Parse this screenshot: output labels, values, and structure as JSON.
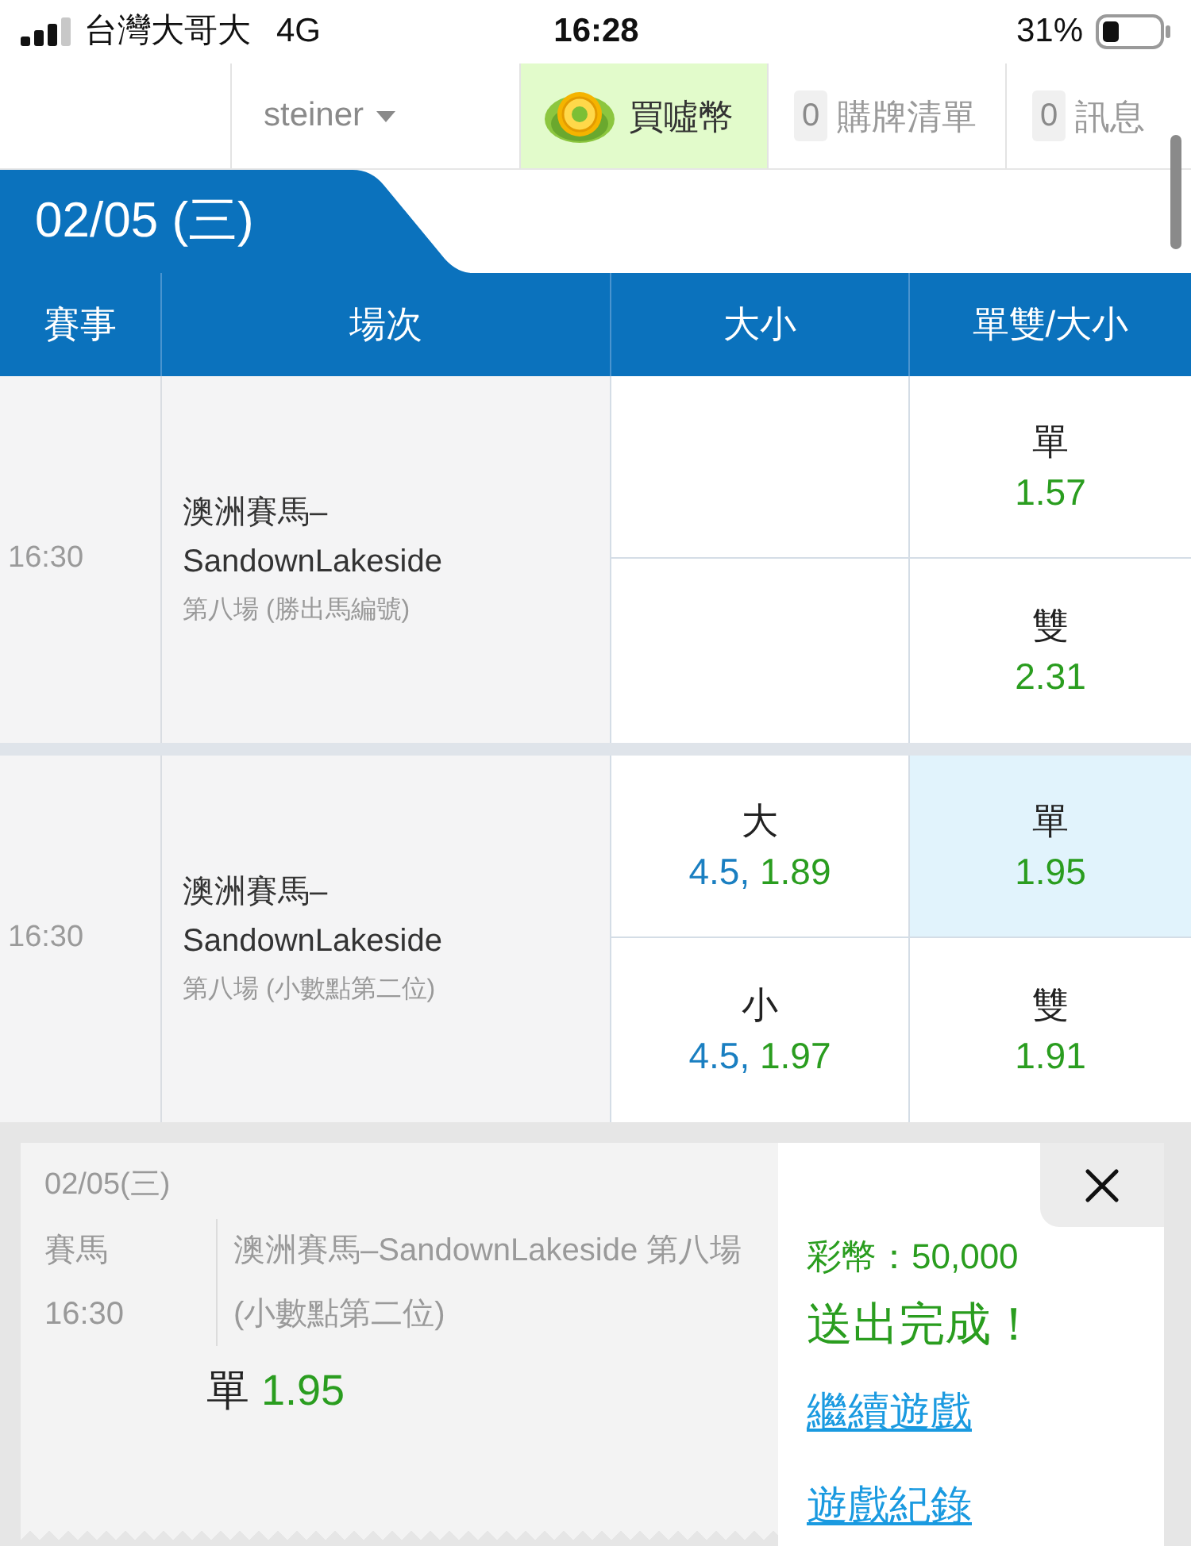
{
  "status_bar": {
    "carrier": "台灣大哥大",
    "network": "4G",
    "time": "16:28",
    "battery": "31%"
  },
  "top_nav": [
    {
      "kind": "user",
      "label": "steiner"
    },
    {
      "kind": "coins",
      "label": "買噓幣"
    },
    {
      "kind": "counter",
      "count": "0",
      "label": "購牌清單"
    },
    {
      "kind": "counter",
      "count": "0",
      "label": "訊息"
    }
  ],
  "date_tab": {
    "label": "02/05 (三)"
  },
  "table": {
    "columns": [
      "賽事",
      "場次",
      "大小",
      "單雙/大小"
    ],
    "rows": [
      {
        "time": "16:30",
        "event": "澳洲賽馬–SandownLakeside",
        "market": "第八場 (勝出馬編號)",
        "odd_even": [
          {
            "label": "單",
            "odds": "1.57",
            "selected": false
          },
          {
            "label": "雙",
            "odds": "2.31",
            "selected": false
          }
        ]
      },
      {
        "time": "16:30",
        "event": "澳洲賽馬–SandownLakeside",
        "market": "第八場 (小數點第二位)",
        "over_under": [
          {
            "label": "大",
            "line": "4.5,",
            "odds": "1.89",
            "selected": false
          },
          {
            "label": "小",
            "line": "4.5,",
            "odds": "1.97",
            "selected": false
          }
        ],
        "odd_even": [
          {
            "label": "單",
            "odds": "1.95",
            "selected": true
          },
          {
            "label": "雙",
            "odds": "1.91",
            "selected": false
          }
        ]
      }
    ]
  },
  "ticket": {
    "date": "02/05(三)",
    "sport": "賽馬",
    "time": "16:30",
    "event": "澳洲賽馬–SandownLakeside 第八場 (小數點第二位)",
    "pick": "單",
    "odds": "1.95",
    "balance": "彩幣：50,000",
    "message": "送出完成！",
    "links": [
      "繼續遊戲",
      "遊戲紀錄"
    ]
  }
}
